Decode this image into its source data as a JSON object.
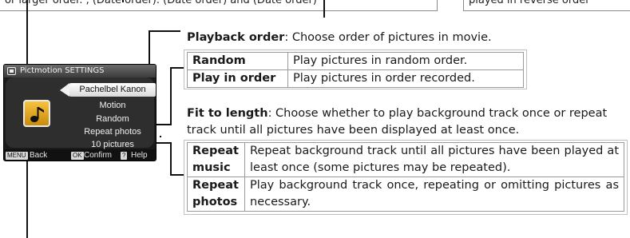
{
  "top_fragments": {
    "left": "or larger order.  ,  (Date order).  (Date order)  and  (Date order)",
    "right": "played in reverse order"
  },
  "lcd": {
    "title": "Pictmotion SETTINGS",
    "items": [
      "Pachelbel Kanon",
      "Motion",
      "Random",
      "Repeat photos",
      "10 pictures"
    ],
    "bottom": {
      "back_key": "MENU",
      "back_label": "Back",
      "confirm_key": "OK",
      "confirm_label": "Confirm",
      "help_key": "?",
      "help_label": "Help"
    }
  },
  "playback_order": {
    "term": "Playback order",
    "desc": ": Choose order of pictures in movie.",
    "rows": [
      {
        "option": "Random",
        "desc": "Play pictures in random order."
      },
      {
        "option": "Play in order",
        "desc": "Play pictures in order recorded."
      }
    ]
  },
  "fit_to_length": {
    "term": "Fit to length",
    "desc": ": Choose whether to play background track once or repeat track until all pictures have been displayed at least once.",
    "rows": [
      {
        "option": "Repeat music",
        "desc": "Repeat background track until all pictures have been played at least once (some pictures may be repeated)."
      },
      {
        "option": "Repeat photos",
        "desc": "Play background track once, repeating or omitting pictures as necessary."
      }
    ]
  }
}
